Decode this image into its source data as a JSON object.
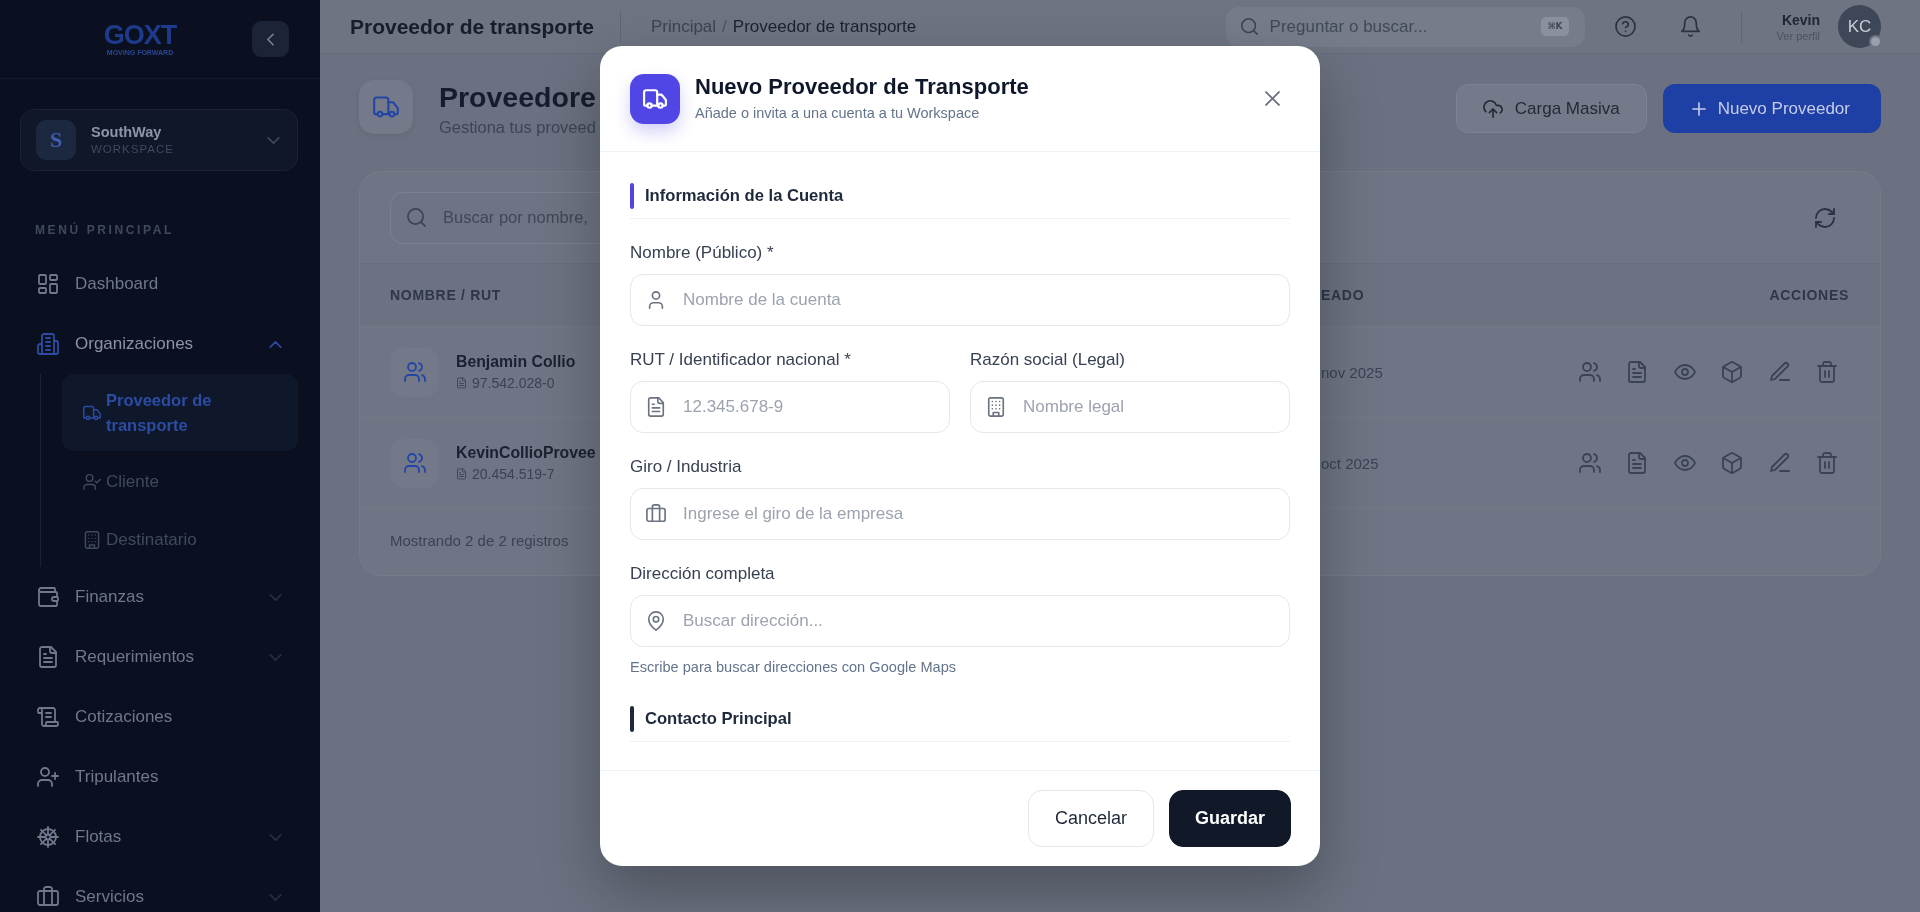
{
  "sidebar": {
    "logo": {
      "wordmark": "GOXT",
      "tagline": "MOVING FORWARD"
    },
    "workspace": {
      "initial": "S",
      "name": "SouthWay",
      "label": "WORKSPACE"
    },
    "section_title": "MENÚ PRINCIPAL",
    "items": [
      {
        "label": "Dashboard",
        "kind": "link",
        "selected": false
      },
      {
        "label": "Organizaciones",
        "kind": "group",
        "expanded": true,
        "selected": false,
        "children": [
          {
            "label": "Proveedor de transporte",
            "selected": true
          },
          {
            "label": "Cliente",
            "selected": false
          },
          {
            "label": "Destinatario",
            "selected": false
          }
        ]
      },
      {
        "label": "Finanzas",
        "kind": "group",
        "expanded": false,
        "selected": false
      },
      {
        "label": "Requerimientos",
        "kind": "group",
        "expanded": false,
        "selected": false
      },
      {
        "label": "Cotizaciones",
        "kind": "link",
        "selected": false
      },
      {
        "label": "Tripulantes",
        "kind": "link",
        "selected": false
      },
      {
        "label": "Flotas",
        "kind": "group",
        "expanded": false,
        "selected": false
      },
      {
        "label": "Servicios",
        "kind": "group",
        "expanded": false,
        "selected": false
      }
    ]
  },
  "top_bar": {
    "title": "Proveedor de transporte",
    "breadcrumb": {
      "items": [
        "Principal",
        "Proveedor de transporte"
      ],
      "separator": "/"
    },
    "search": {
      "placeholder": "Preguntar o buscar...",
      "shortcut": "⌘K"
    },
    "user": {
      "name": "Kevin",
      "subtitle": "Ver perfil",
      "initials": "KC"
    }
  },
  "page_header": {
    "title": "Proveedore",
    "subtitle": "Gestiona tus proveed",
    "actions": [
      {
        "label": "Carga Masiva",
        "kind": "secondary"
      },
      {
        "label": "Nuevo Proveedor",
        "kind": "primary"
      }
    ]
  },
  "table": {
    "search": {
      "placeholder": "Buscar por nombre,"
    },
    "columns": [
      "NOMBRE / RUT",
      "EADO",
      "ACCIONES"
    ],
    "rows": [
      {
        "name": "Benjamin Collio",
        "rut": "97.542.028-0",
        "column_2": "nov 2025"
      },
      {
        "name": "KevinCollioProvee",
        "rut": "20.454.519-7",
        "column_2": "oct 2025"
      }
    ],
    "footer": "Mostrando 2 de 2 registros"
  },
  "modal": {
    "title": "Nuevo Proveedor de Transporte",
    "subtitle": "Añade o invita a una cuenta a tu Workspace",
    "sections": [
      {
        "title": "Información de la Cuenta",
        "color": "#4f46e5",
        "rows": [
          {
            "fields": [
              {
                "label": "Nombre (Público) *",
                "placeholder": "Nombre de la cuenta"
              }
            ]
          },
          {
            "fields": [
              {
                "label": "RUT / Identificador nacional *",
                "placeholder": "12.345.678-9"
              },
              {
                "label": "Razón social (Legal)",
                "placeholder": "Nombre legal"
              }
            ]
          },
          {
            "fields": [
              {
                "label": "Giro / Industria",
                "placeholder": "Ingrese el giro de la empresa"
              }
            ]
          },
          {
            "fields": [
              {
                "label": "Dirección completa",
                "placeholder": "Buscar dirección...",
                "help": "Escribe para buscar direcciones con Google Maps"
              }
            ]
          }
        ]
      },
      {
        "title": "Contacto Principal",
        "color": "#1e293b"
      }
    ],
    "buttons": [
      {
        "label": "Cancelar",
        "kind": "secondary"
      },
      {
        "label": "Guardar",
        "kind": "primary"
      }
    ]
  }
}
